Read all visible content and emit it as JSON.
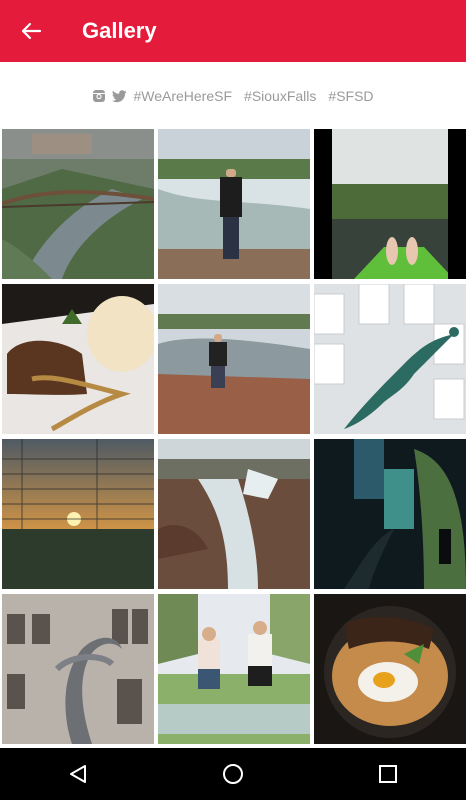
{
  "appbar": {
    "title": "Gallery",
    "back_icon": "arrow-left-icon",
    "color": "#e41b3a"
  },
  "social": {
    "icons": [
      "instagram-icon",
      "twitter-icon"
    ],
    "hashtags": [
      "#WeAreHereSF",
      "#SiouxFalls",
      "#SFSD"
    ]
  },
  "gallery": {
    "photos": [
      {
        "subject": "river-bridge"
      },
      {
        "subject": "man-at-falls"
      },
      {
        "subject": "kayak-feet"
      },
      {
        "subject": "dessert-ice-cream"
      },
      {
        "subject": "man-on-rocks"
      },
      {
        "subject": "mermaid-sculpture"
      },
      {
        "subject": "sunset-fence"
      },
      {
        "subject": "waterfall-rocks"
      },
      {
        "subject": "dark-stairway"
      },
      {
        "subject": "stone-building-sculpture"
      },
      {
        "subject": "two-women-jumping"
      },
      {
        "subject": "food-plate-egg"
      }
    ]
  },
  "system_nav": {
    "icons": [
      "back-triangle-icon",
      "home-circle-icon",
      "recents-square-icon"
    ]
  }
}
